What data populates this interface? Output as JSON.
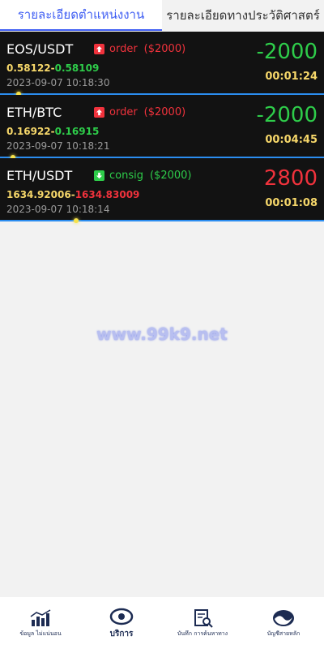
{
  "tabs": [
    {
      "label": "รายละเอียดตำแหน่งงาน"
    },
    {
      "label": "รายละเอียดทางประวัติศาสตร์"
    }
  ],
  "orders": [
    {
      "symbol": "EOS/USDT",
      "direction": "up",
      "type": "order",
      "stake": "($2000)",
      "open_price": "0.58122",
      "close_price": "0.58109",
      "close_color": "#2ecc4a",
      "datetime": "2023-09-07 10:18:30",
      "amount": "-2000",
      "amount_color": "#2ecc4a",
      "elapsed": "00:01:24",
      "badge_color": "#f0323c"
    },
    {
      "symbol": "ETH/BTC",
      "direction": "up",
      "type": "order",
      "stake": "($2000)",
      "open_price": "0.16922",
      "close_price": "0.16915",
      "close_color": "#2ecc4a",
      "datetime": "2023-09-07 10:18:21",
      "amount": "-2000",
      "amount_color": "#2ecc4a",
      "elapsed": "00:04:45",
      "badge_color": "#f0323c"
    },
    {
      "symbol": "ETH/USDT",
      "direction": "down",
      "type": "consig",
      "stake": "($2000)",
      "open_price": "1634.92006",
      "close_price": "1634.83009",
      "close_color": "#f0323c",
      "datetime": "2023-09-07 10:18:14",
      "amount": "2800",
      "amount_color": "#f0323c",
      "elapsed": "00:01:08",
      "badge_color": "#2ecc4a"
    }
  ],
  "watermark": "www.99k9.net",
  "bottom_nav": [
    {
      "label": "ข้อมูล ไม่แน่นอน",
      "icon": "chart-icon"
    },
    {
      "label": "บริการ",
      "icon": "eye-icon"
    },
    {
      "label": "บันทึก การค้นหาทาง",
      "icon": "search-doc-icon"
    },
    {
      "label": "บัญชีสายหลัก",
      "icon": "wave-icon"
    }
  ]
}
